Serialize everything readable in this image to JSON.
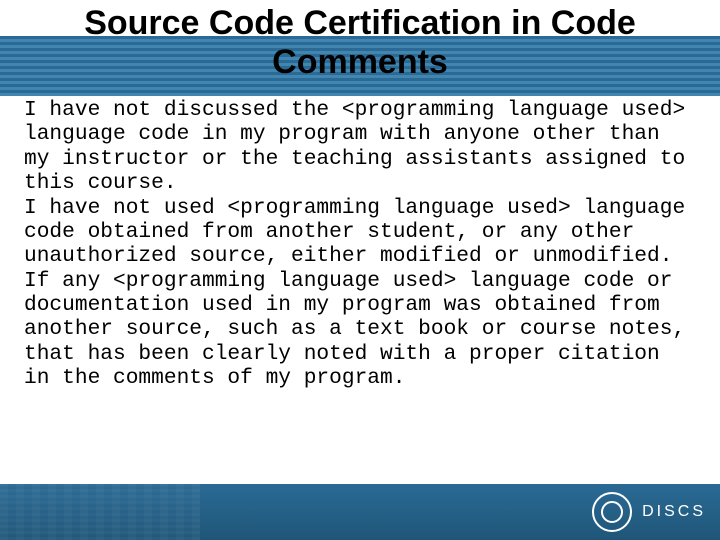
{
  "title": "Source Code Certification in Code Comments",
  "body": "I have not discussed the <programming language used> language code in my program with anyone other than my instructor or the teaching assistants assigned to this course.\nI have not used <programming language used> language code obtained from another student, or any other unauthorized source, either modified or unmodified.\nIf any <programming language used> language code or documentation used in my program was obtained from another source, such as a text book or course notes, that has been clearly noted with a proper citation in the comments of my program.",
  "footer": {
    "org": "DISCS"
  }
}
